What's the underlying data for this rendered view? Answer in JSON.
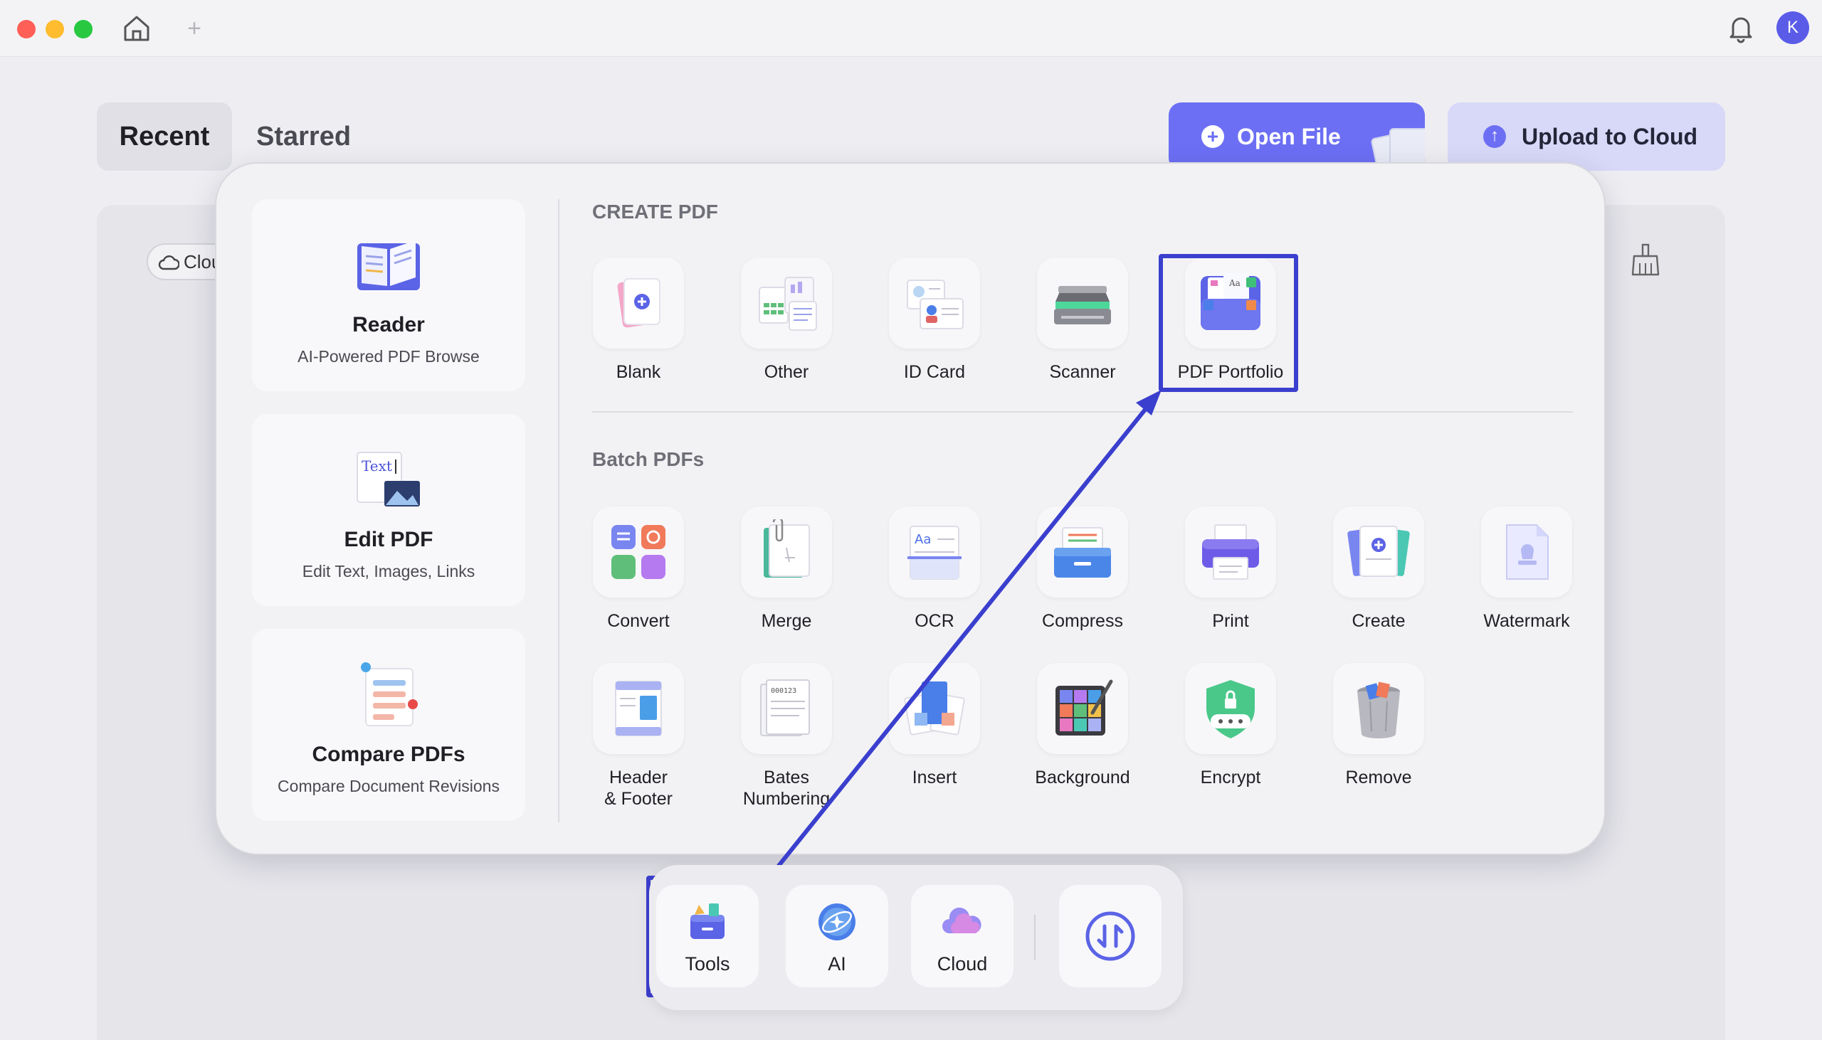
{
  "window": {
    "new_tab_symbol": "+",
    "avatar_letter": "K"
  },
  "header": {
    "tabs": [
      {
        "label": "Recent",
        "active": true
      },
      {
        "label": "Starred",
        "active": false
      }
    ],
    "open_file_label": "Open File",
    "upload_label": "Upload to Cloud"
  },
  "content": {
    "cloud_chip_label": "Clou"
  },
  "popup": {
    "side_cards": [
      {
        "title": "Reader",
        "subtitle": "AI-Powered PDF Browse",
        "icon": "book-icon"
      },
      {
        "title": "Edit PDF",
        "subtitle": "Edit Text, Images, Links",
        "icon": "edit-text-icon"
      },
      {
        "title": "Compare PDFs",
        "subtitle": "Compare Document Revisions",
        "icon": "compare-icon"
      }
    ],
    "create_title": "CREATE PDF",
    "create_items": [
      {
        "label": "Blank",
        "icon": "blank-icon"
      },
      {
        "label": "Other",
        "icon": "other-icon"
      },
      {
        "label": "ID Card",
        "icon": "id-card-icon"
      },
      {
        "label": "Scanner",
        "icon": "scanner-icon"
      },
      {
        "label": "PDF Portfolio",
        "icon": "portfolio-icon"
      }
    ],
    "batch_title": "Batch PDFs",
    "batch_row1": [
      {
        "label": "Convert",
        "icon": "convert-icon"
      },
      {
        "label": "Merge",
        "icon": "merge-icon"
      },
      {
        "label": "OCR",
        "icon": "ocr-icon"
      },
      {
        "label": "Compress",
        "icon": "compress-icon"
      },
      {
        "label": "Print",
        "icon": "print-icon"
      },
      {
        "label": "Create",
        "icon": "create-icon"
      },
      {
        "label": "Watermark",
        "icon": "watermark-icon"
      }
    ],
    "batch_row2": [
      {
        "label": "Header\n& Footer",
        "icon": "header-footer-icon"
      },
      {
        "label": "Bates\nNumbering",
        "icon": "bates-icon"
      },
      {
        "label": "Insert",
        "icon": "insert-icon"
      },
      {
        "label": "Background",
        "icon": "background-icon"
      },
      {
        "label": "Encrypt",
        "icon": "encrypt-icon"
      },
      {
        "label": "Remove",
        "icon": "remove-icon"
      }
    ]
  },
  "dock": {
    "items": [
      {
        "label": "Tools",
        "icon": "tools-icon"
      },
      {
        "label": "AI",
        "icon": "ai-icon"
      },
      {
        "label": "Cloud",
        "icon": "cloud-icon"
      }
    ],
    "extra_icon": "sort-icon"
  },
  "colors": {
    "accent": "#6c6ff4",
    "highlight": "#3b3fce",
    "avatar": "#5a5ce8"
  }
}
